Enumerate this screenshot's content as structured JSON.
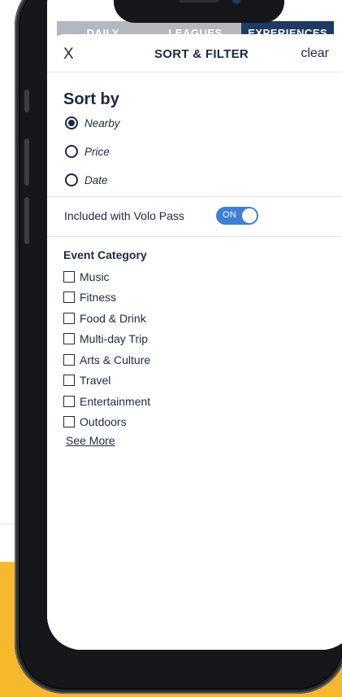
{
  "tabs": [
    "DAILY",
    "LEAGUES",
    "EXPERIENCES"
  ],
  "header": {
    "close_label": "X",
    "title": "SORT & FILTER",
    "clear_label": "clear"
  },
  "sort": {
    "title": "Sort by",
    "options": [
      {
        "label": "Nearby",
        "selected": true
      },
      {
        "label": "Price",
        "selected": false
      },
      {
        "label": "Date",
        "selected": false
      }
    ]
  },
  "volo_pass": {
    "label": "Included with Volo Pass",
    "toggle_text": "ON",
    "enabled": true
  },
  "category": {
    "title": "Event Category",
    "items": [
      "Music",
      "Fitness",
      "Food & Drink",
      "Multi-day Trip",
      "Arts & Culture",
      "Travel",
      "Entertainment",
      "Outdoors"
    ],
    "see_more": "See More"
  },
  "colors": {
    "navy": "#1b2a44",
    "accent_blue": "#3d7fd9",
    "tab_active": "#1d3b63",
    "background_yellow": "#f6b92e"
  }
}
